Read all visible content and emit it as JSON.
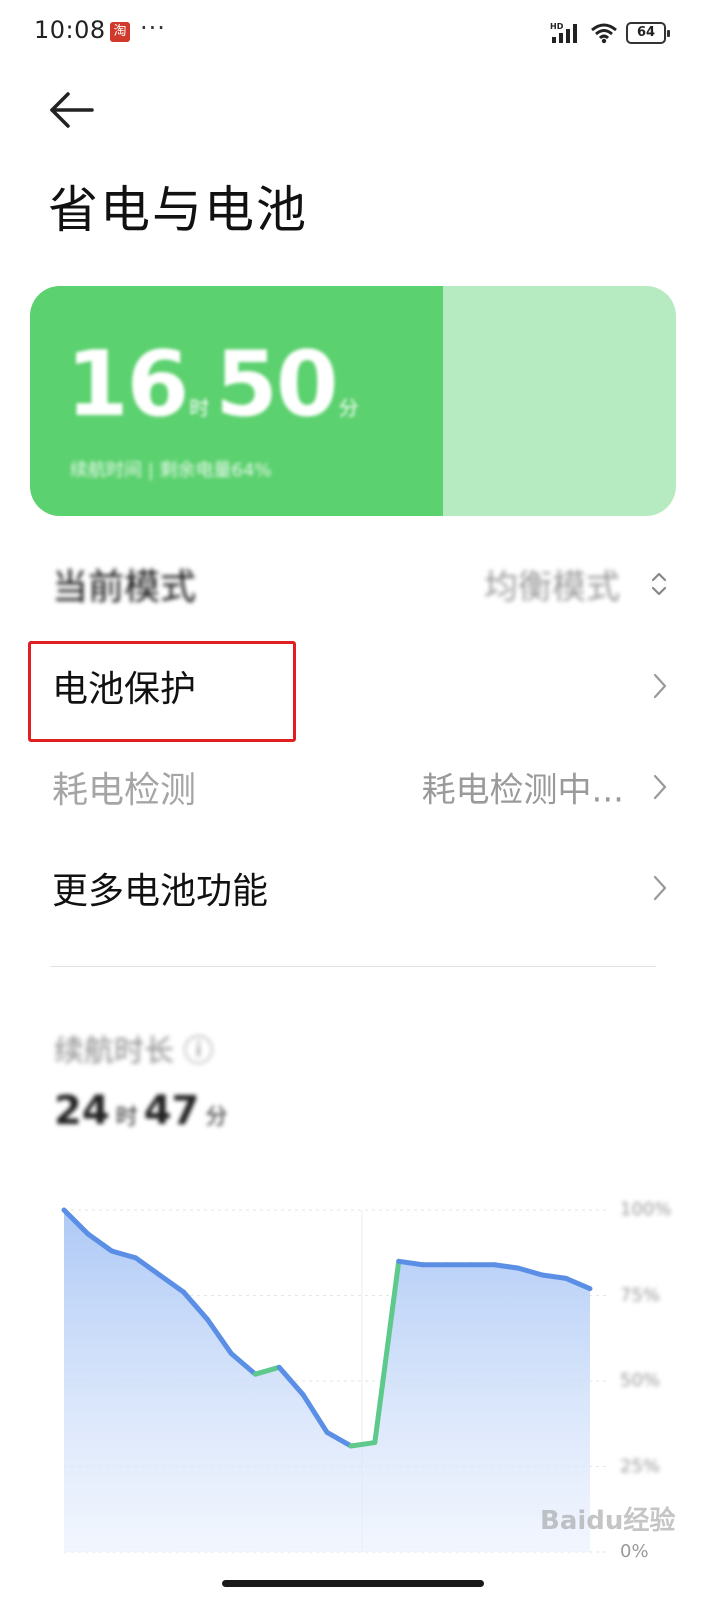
{
  "status_bar": {
    "time": "10:08",
    "notification_app": "淘",
    "more": "···",
    "network": "HD",
    "battery_level": "64"
  },
  "header": {
    "title": "省电与电池"
  },
  "battery_card": {
    "hours": "16",
    "hours_unit": "时",
    "minutes": "50",
    "minutes_unit": "分",
    "subtitle": "续航时间 | 剩余电量64%",
    "fill_fraction": 0.64,
    "fill_color": "#5cd16f",
    "track_color": "#b6ebc2"
  },
  "settings": {
    "current_mode": {
      "label": "当前模式",
      "value": "均衡模式"
    },
    "battery_protection": {
      "label": "电池保护"
    },
    "power_detection": {
      "label": "耗电检测",
      "value": "耗电检测中..."
    },
    "more_battery": {
      "label": "更多电池功能"
    }
  },
  "usage": {
    "label": "续航时长",
    "hours": "24",
    "hours_unit": "时",
    "minutes": "47",
    "minutes_unit": "分"
  },
  "chart_data": {
    "type": "area",
    "series": [
      {
        "values": [
          100,
          93,
          88,
          86,
          81,
          76,
          68,
          58,
          52,
          54,
          46,
          35,
          31,
          32,
          85,
          84,
          84,
          84,
          84,
          83,
          81,
          80,
          77
        ]
      }
    ],
    "ylim": [
      0,
      100
    ],
    "ytick_labels": [
      "100%",
      "75%",
      "50%",
      "25%",
      "0%"
    ],
    "charging_color": "#5dc98a",
    "discharging_color": "#5b8fe6"
  },
  "watermark": "Baidu经验",
  "colors": {
    "highlight": "#e02020"
  }
}
